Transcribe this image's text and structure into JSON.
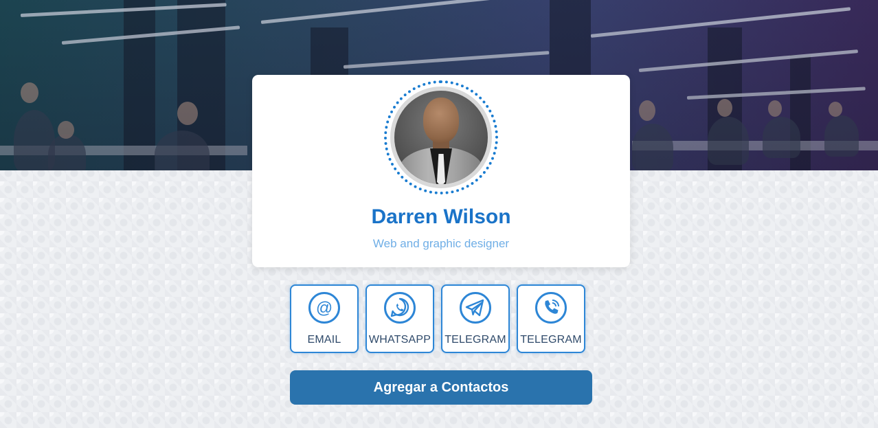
{
  "profile": {
    "name": "Darren Wilson",
    "role": "Web and graphic designer"
  },
  "contacts": [
    {
      "label": "EMAIL",
      "icon": "email-at-icon"
    },
    {
      "label": "WHATSAPP",
      "icon": "whatsapp-icon"
    },
    {
      "label": "TELEGRAM",
      "icon": "telegram-icon"
    },
    {
      "label": "TELEGRAM",
      "icon": "phone-call-icon"
    }
  ],
  "actions": {
    "add_contact_label": "Agregar a Contactos"
  },
  "colors": {
    "accent": "#1a73c8",
    "button": "#2a73ad",
    "icon": "#2d86d6"
  }
}
